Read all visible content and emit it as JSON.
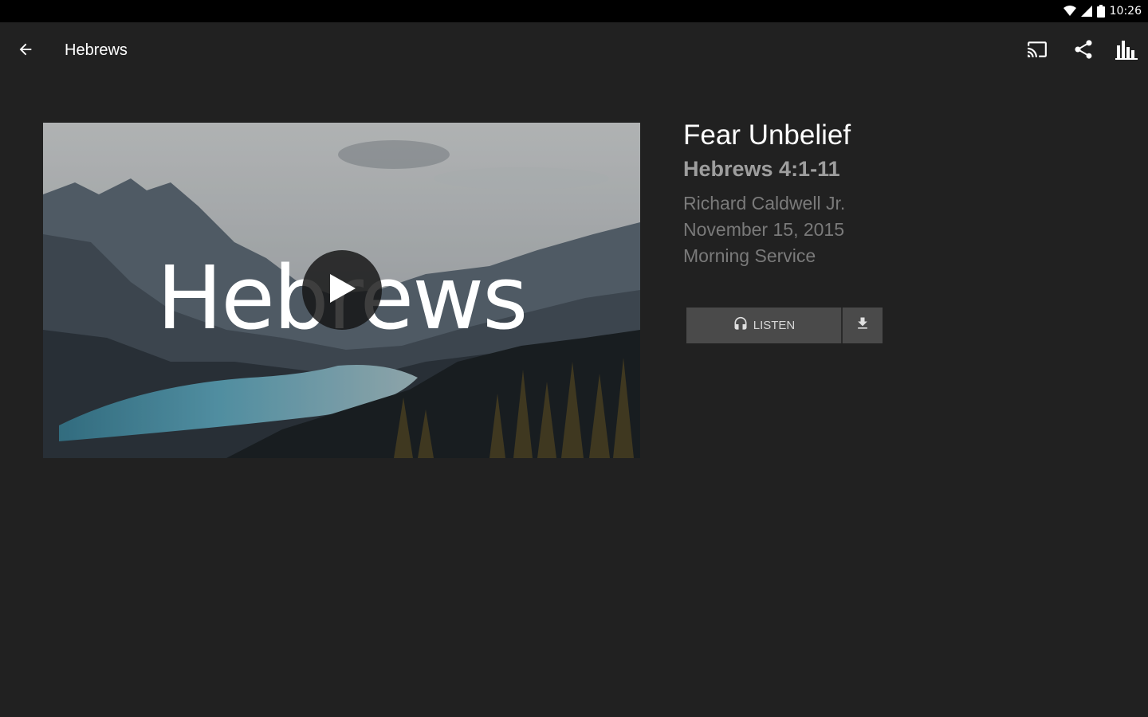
{
  "status_bar": {
    "time": "10:26",
    "icons": [
      "wifi-icon",
      "signal-icon",
      "battery-icon"
    ]
  },
  "app_bar": {
    "title": "Hebrews",
    "back_icon": "arrow-back-icon",
    "actions": [
      "cast-icon",
      "share-icon",
      "bar-chart-icon"
    ]
  },
  "media": {
    "thumbnail_title": "Hebrews",
    "play_icon": "play-icon"
  },
  "sermon": {
    "title": "Fear Unbelief",
    "scripture": "Hebrews 4:1-11",
    "speaker": "Richard Caldwell Jr.",
    "date": "November 15, 2015",
    "service": "Morning Service"
  },
  "buttons": {
    "listen_label": "LISTEN",
    "listen_icon": "headphones-icon",
    "download_icon": "download-icon"
  },
  "colors": {
    "background": "#212121",
    "status_bar": "#000000",
    "button": "#4a4a4a",
    "primary_text": "#ffffff",
    "secondary_text": "#9e9e9e",
    "tertiary_text": "#7a7a7a"
  }
}
